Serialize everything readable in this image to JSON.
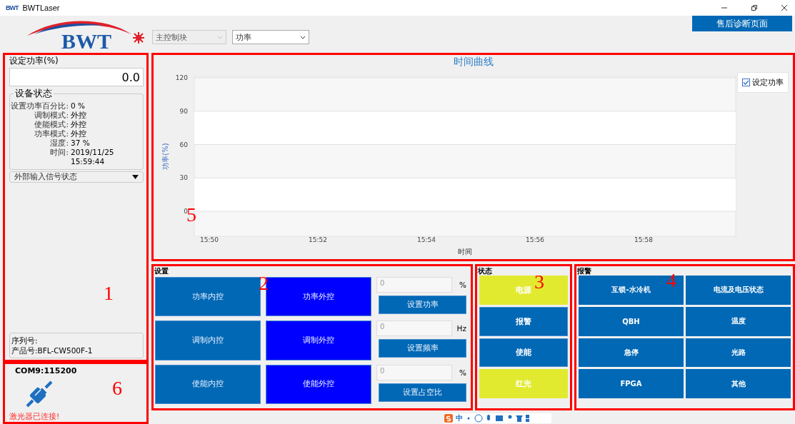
{
  "window": {
    "title": "BWTLaser",
    "app_icon": "BWT"
  },
  "header": {
    "logo": "BWT",
    "module_select": {
      "value": "主控制块",
      "disabled": true
    },
    "curve_select": {
      "value": "功率"
    },
    "service_button": "售后诊断页面"
  },
  "sidebar": {
    "annotation": "1",
    "power_label": "设定功率(%)",
    "power_value": "0.0",
    "status_title": "设备状态",
    "status_rows": [
      {
        "label": "设置功率百分比:",
        "value": "0 %"
      },
      {
        "label": "调制模式:",
        "value": "外控"
      },
      {
        "label": "使能模式:",
        "value": "外控"
      },
      {
        "label": "功率模式:",
        "value": "外控"
      },
      {
        "label": "湿度:",
        "value": "37 %"
      },
      {
        "label": "时间:",
        "value": "2019/11/25"
      },
      {
        "label": "",
        "value": "15:59:44"
      }
    ],
    "signal_section": {
      "title": "外部输入信号状态",
      "expanded": false
    },
    "serial_label": "序列号:",
    "product_label": "产品号:BFL-CW500F-1"
  },
  "connection": {
    "annotation": "6",
    "port": "COM9:115200",
    "connected": true,
    "message": "激光器已连接!"
  },
  "chart_panel": {
    "annotation": "5",
    "legend": {
      "checked": true
    },
    "chart_data": {
      "type": "line",
      "grid": true,
      "title": "时间曲线",
      "xlabel": "时间",
      "ylabel": "功率(%)",
      "categories": [
        "15:50",
        "15:52",
        "15:54",
        "15:56",
        "15:58"
      ],
      "series": [
        {
          "name": "设定功率",
          "color": "#3a6fc4",
          "values": [
            null,
            null,
            null,
            null,
            null
          ]
        }
      ],
      "ylim": [
        0,
        120
      ],
      "yticks": [
        0,
        30,
        60,
        90,
        120
      ]
    }
  },
  "settings": {
    "annotation": "2",
    "title": "设置",
    "rows": [
      {
        "internal": {
          "label": "功率内控",
          "selected": false
        },
        "external": {
          "label": "功率外控",
          "selected": true
        },
        "input": "0",
        "unit": "%",
        "button": "设置功率"
      },
      {
        "internal": {
          "label": "调制内控",
          "selected": false
        },
        "external": {
          "label": "调制外控",
          "selected": true
        },
        "input": "0",
        "unit": "Hz",
        "button": "设置频率"
      },
      {
        "internal": {
          "label": "使能内控",
          "selected": false
        },
        "external": {
          "label": "使能外控",
          "selected": true
        },
        "input": "0",
        "unit": "%",
        "button": "设置占空比"
      }
    ]
  },
  "status": {
    "annotation": "3",
    "title": "状态",
    "items": [
      {
        "label": "电源",
        "on": true
      },
      {
        "label": "报警",
        "on": false
      },
      {
        "label": "使能",
        "on": false
      },
      {
        "label": "红光",
        "on": true
      }
    ]
  },
  "alarms": {
    "annotation": "4",
    "title": "报警",
    "items": [
      "互锁-水冷机",
      "电流及电压状态",
      "QBH",
      "温度",
      "急停",
      "光路",
      "FPGA",
      "其他"
    ]
  },
  "ime_toolbar": {
    "label": "中"
  }
}
